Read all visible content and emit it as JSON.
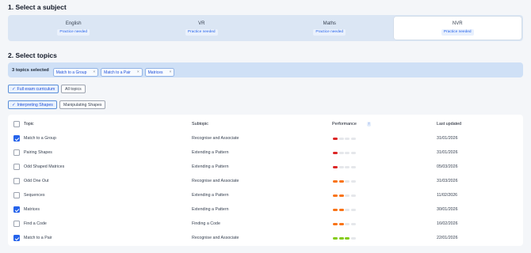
{
  "section1": {
    "title": "1. Select a subject"
  },
  "subjects": [
    {
      "name": "English",
      "badge": "Practice needed",
      "active": false
    },
    {
      "name": "VR",
      "badge": "Practice needed",
      "active": false
    },
    {
      "name": "Maths",
      "badge": "Practice needed",
      "active": false
    },
    {
      "name": "NVR",
      "badge": "Practice needed",
      "active": true
    }
  ],
  "section2": {
    "title": "2. Select topics"
  },
  "selection": {
    "count_label": "3 topics selected",
    "chips": [
      "Match to a Group",
      "Match to a Pair",
      "Matrices"
    ],
    "remove_glyph": "×"
  },
  "filters": {
    "curriculum": {
      "label": "Full exam curriculum",
      "on": true
    },
    "all_topics": {
      "label": "All topics",
      "on": false
    },
    "interpreting": {
      "label": "Interpreting Shapes",
      "on": true
    },
    "manipulating": {
      "label": "Manipulating Shapes",
      "on": false
    },
    "check_glyph": "✓"
  },
  "table": {
    "headers": {
      "topic": "Topic",
      "subtopic": "Subtopic",
      "performance": "Performance",
      "sort_glyph": "↑",
      "updated": "Last updated"
    },
    "rows": [
      {
        "topic": "Match to a Group",
        "subtopic": "Recognise and Associate",
        "perf": [
          "red",
          "grey",
          "grey",
          "grey"
        ],
        "date": "31/01/2026",
        "checked": true
      },
      {
        "topic": "Pairing Shapes",
        "subtopic": "Extending a Pattern",
        "perf": [
          "red",
          "grey",
          "grey",
          "grey"
        ],
        "date": "31/01/2026",
        "checked": false
      },
      {
        "topic": "Odd Shaped Matrices",
        "subtopic": "Extending a Pattern",
        "perf": [
          "red",
          "grey",
          "grey",
          "grey"
        ],
        "date": "05/03/2026",
        "checked": false
      },
      {
        "topic": "Odd One Out",
        "subtopic": "Recognise and Associate",
        "perf": [
          "orange",
          "orange",
          "grey",
          "grey"
        ],
        "date": "31/03/2026",
        "checked": false
      },
      {
        "topic": "Sequences",
        "subtopic": "Extending a Pattern",
        "perf": [
          "orange",
          "orange",
          "grey",
          "grey"
        ],
        "date": "11/02/2026",
        "checked": false
      },
      {
        "topic": "Matrices",
        "subtopic": "Extending a Pattern",
        "perf": [
          "orange",
          "orange",
          "grey",
          "grey"
        ],
        "date": "30/01/2026",
        "checked": true
      },
      {
        "topic": "Find a Code",
        "subtopic": "Finding a Code",
        "perf": [
          "orange",
          "orange",
          "grey",
          "grey"
        ],
        "date": "16/02/2026",
        "checked": false
      },
      {
        "topic": "Match to a Pair",
        "subtopic": "Recognise and Associate",
        "perf": [
          "green",
          "green",
          "green",
          "grey"
        ],
        "date": "22/01/2026",
        "checked": true
      }
    ]
  }
}
